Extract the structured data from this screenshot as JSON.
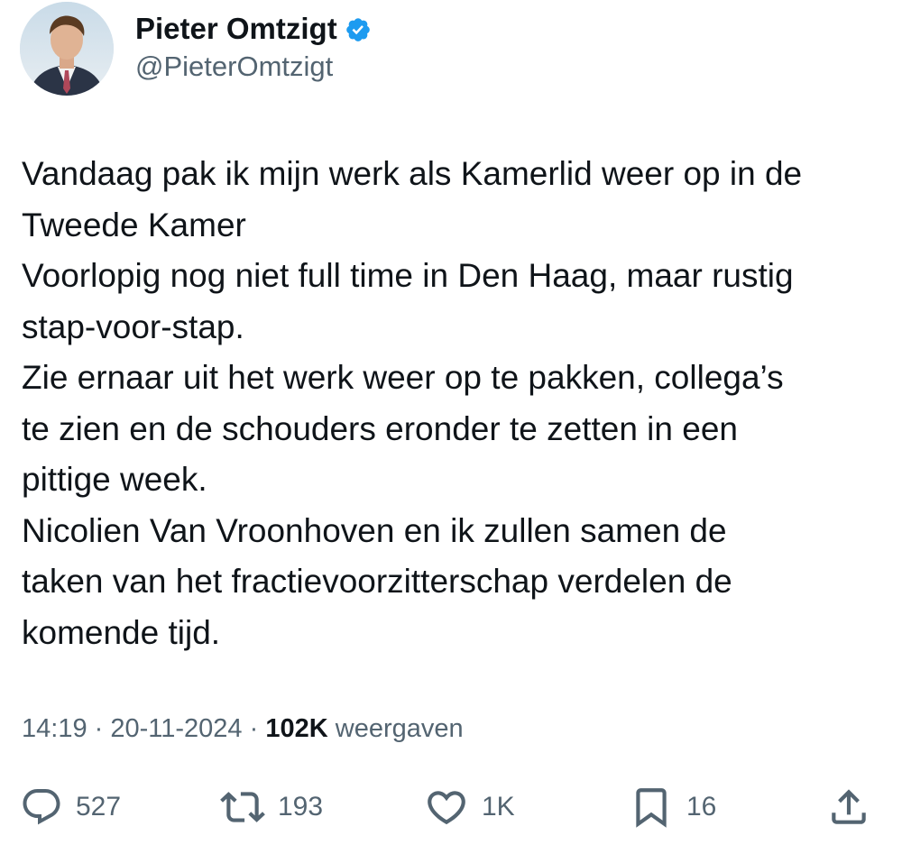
{
  "author": {
    "display_name": "Pieter Omtzigt",
    "handle": "@PieterOmtzigt",
    "verified": true,
    "verified_color": "#1d9bf0"
  },
  "tweet": {
    "lines": [
      "Vandaag pak ik mijn werk als Kamerlid weer op in de",
      "Tweede Kamer",
      "Voorlopig nog niet full time in Den Haag, maar rustig",
      "stap-voor-stap.",
      "Zie ernaar uit het werk weer op te pakken, collega’s",
      "te zien en de schouders eronder te zetten in een",
      "pittige week.",
      "Nicolien Van Vroonhoven en ik zullen samen de",
      "taken van het fractievoorzitterschap verdelen de",
      "komende tijd."
    ]
  },
  "meta": {
    "time": "14:19",
    "separator": "·",
    "date": "20-11-2024",
    "views_count": "102K",
    "views_label": "weergaven"
  },
  "actions": {
    "reply": {
      "icon": "reply-icon",
      "count": "527"
    },
    "retweet": {
      "icon": "retweet-icon",
      "count": "193"
    },
    "like": {
      "icon": "heart-icon",
      "count": "1K"
    },
    "bookmark": {
      "icon": "bookmark-icon",
      "count": "16"
    },
    "share": {
      "icon": "share-icon"
    }
  },
  "colors": {
    "text_primary": "#0f1419",
    "text_secondary": "#536471",
    "background": "#ffffff"
  }
}
